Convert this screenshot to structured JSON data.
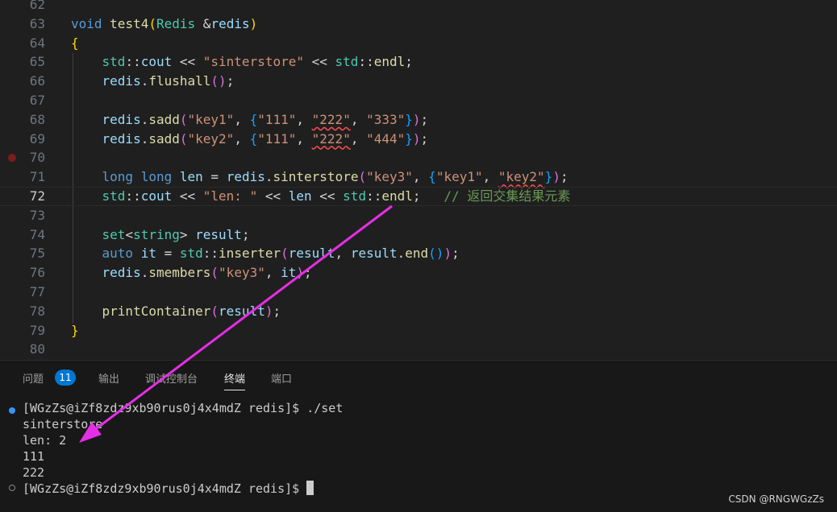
{
  "editor": {
    "lines": [
      {
        "num": "62",
        "tokens": []
      },
      {
        "num": "63",
        "tokens": [
          [
            "void",
            "#569cd6"
          ],
          [
            " ",
            ""
          ],
          [
            "test4",
            "#dcdcaa"
          ],
          [
            "(",
            "#ffd700"
          ],
          [
            "Redis",
            "#4ec9b0"
          ],
          [
            " ",
            ""
          ],
          [
            "&",
            "#d4d4d4"
          ],
          [
            "redis",
            "#9cdcfe"
          ],
          [
            ")",
            "#ffd700"
          ]
        ]
      },
      {
        "num": "64",
        "tokens": [
          [
            "{",
            "#ffd700"
          ]
        ]
      },
      {
        "num": "65",
        "tokens": [
          [
            "    ",
            ""
          ],
          [
            "std",
            "#4ec9b0"
          ],
          [
            "::",
            "#d4d4d4"
          ],
          [
            "cout",
            "#9cdcfe"
          ],
          [
            " << ",
            "#d4d4d4"
          ],
          [
            "\"sinterstore\"",
            "#ce9178"
          ],
          [
            " << ",
            "#d4d4d4"
          ],
          [
            "std",
            "#4ec9b0"
          ],
          [
            "::",
            "#d4d4d4"
          ],
          [
            "endl",
            "#dcdcaa"
          ],
          [
            ";",
            "#d4d4d4"
          ]
        ]
      },
      {
        "num": "66",
        "tokens": [
          [
            "    ",
            ""
          ],
          [
            "redis",
            "#9cdcfe"
          ],
          [
            ".",
            "#d4d4d4"
          ],
          [
            "flushall",
            "#dcdcaa"
          ],
          [
            "(",
            "#da70d6"
          ],
          [
            ")",
            "#da70d6"
          ],
          [
            ";",
            "#d4d4d4"
          ]
        ]
      },
      {
        "num": "67",
        "tokens": []
      },
      {
        "num": "68",
        "tokens": [
          [
            "    ",
            ""
          ],
          [
            "redis",
            "#9cdcfe"
          ],
          [
            ".",
            "#d4d4d4"
          ],
          [
            "sadd",
            "#dcdcaa"
          ],
          [
            "(",
            "#da70d6"
          ],
          [
            "\"key1\"",
            "#ce9178"
          ],
          [
            ", ",
            "#d4d4d4"
          ],
          [
            "{",
            "#179fff"
          ],
          [
            "\"111\"",
            "#ce9178"
          ],
          [
            ", ",
            "#d4d4d4"
          ],
          [
            "\"222\"",
            "#ce9178",
            "sq"
          ],
          [
            ", ",
            "#d4d4d4"
          ],
          [
            "\"333\"",
            "#ce9178"
          ],
          [
            "}",
            "#179fff"
          ],
          [
            ")",
            "#da70d6"
          ],
          [
            ";",
            "#d4d4d4"
          ]
        ]
      },
      {
        "num": "69",
        "tokens": [
          [
            "    ",
            ""
          ],
          [
            "redis",
            "#9cdcfe"
          ],
          [
            ".",
            "#d4d4d4"
          ],
          [
            "sadd",
            "#dcdcaa"
          ],
          [
            "(",
            "#da70d6"
          ],
          [
            "\"key2\"",
            "#ce9178"
          ],
          [
            ", ",
            "#d4d4d4"
          ],
          [
            "{",
            "#179fff"
          ],
          [
            "\"111\"",
            "#ce9178"
          ],
          [
            ", ",
            "#d4d4d4"
          ],
          [
            "\"222\"",
            "#ce9178",
            "sq"
          ],
          [
            ", ",
            "#d4d4d4"
          ],
          [
            "\"444\"",
            "#ce9178"
          ],
          [
            "}",
            "#179fff"
          ],
          [
            ")",
            "#da70d6"
          ],
          [
            ";",
            "#d4d4d4"
          ]
        ]
      },
      {
        "num": "70",
        "tokens": [],
        "breakpoint": true
      },
      {
        "num": "71",
        "tokens": [
          [
            "    ",
            ""
          ],
          [
            "long",
            "#569cd6"
          ],
          [
            " ",
            ""
          ],
          [
            "long",
            "#569cd6"
          ],
          [
            " ",
            ""
          ],
          [
            "len",
            "#9cdcfe"
          ],
          [
            " = ",
            "#d4d4d4"
          ],
          [
            "redis",
            "#9cdcfe"
          ],
          [
            ".",
            "#d4d4d4"
          ],
          [
            "sinterstore",
            "#dcdcaa"
          ],
          [
            "(",
            "#da70d6"
          ],
          [
            "\"key3\"",
            "#ce9178"
          ],
          [
            ", ",
            "#d4d4d4"
          ],
          [
            "{",
            "#179fff"
          ],
          [
            "\"key1\"",
            "#ce9178"
          ],
          [
            ", ",
            "#d4d4d4"
          ],
          [
            "\"key2\"",
            "#ce9178",
            "sq"
          ],
          [
            "}",
            "#179fff"
          ],
          [
            ")",
            "#da70d6"
          ],
          [
            ";",
            "#d4d4d4"
          ]
        ]
      },
      {
        "num": "72",
        "active": true,
        "tokens": [
          [
            "    ",
            ""
          ],
          [
            "std",
            "#4ec9b0"
          ],
          [
            "::",
            "#d4d4d4"
          ],
          [
            "cout",
            "#9cdcfe"
          ],
          [
            " << ",
            "#d4d4d4"
          ],
          [
            "\"len: \"",
            "#ce9178"
          ],
          [
            " << ",
            "#d4d4d4"
          ],
          [
            "len",
            "#9cdcfe"
          ],
          [
            " << ",
            "#d4d4d4"
          ],
          [
            "std",
            "#4ec9b0"
          ],
          [
            "::",
            "#d4d4d4"
          ],
          [
            "endl",
            "#dcdcaa"
          ],
          [
            ";",
            "#d4d4d4"
          ],
          [
            "   ",
            ""
          ],
          [
            "// 返回交集结果元素",
            "#6a9955"
          ]
        ]
      },
      {
        "num": "73",
        "tokens": []
      },
      {
        "num": "74",
        "tokens": [
          [
            "    ",
            ""
          ],
          [
            "set",
            "#4ec9b0"
          ],
          [
            "<",
            "#d4d4d4"
          ],
          [
            "string",
            "#4ec9b0"
          ],
          [
            "> ",
            "#d4d4d4"
          ],
          [
            "result",
            "#9cdcfe"
          ],
          [
            ";",
            "#d4d4d4"
          ]
        ]
      },
      {
        "num": "75",
        "tokens": [
          [
            "    ",
            ""
          ],
          [
            "auto",
            "#569cd6"
          ],
          [
            " ",
            ""
          ],
          [
            "it",
            "#9cdcfe"
          ],
          [
            " = ",
            "#d4d4d4"
          ],
          [
            "std",
            "#4ec9b0"
          ],
          [
            "::",
            "#d4d4d4"
          ],
          [
            "inserter",
            "#dcdcaa"
          ],
          [
            "(",
            "#da70d6"
          ],
          [
            "result",
            "#9cdcfe"
          ],
          [
            ", ",
            "#d4d4d4"
          ],
          [
            "result",
            "#9cdcfe"
          ],
          [
            ".",
            "#d4d4d4"
          ],
          [
            "end",
            "#dcdcaa"
          ],
          [
            "(",
            "#179fff"
          ],
          [
            ")",
            "#179fff"
          ],
          [
            ")",
            "#da70d6"
          ],
          [
            ";",
            "#d4d4d4"
          ]
        ]
      },
      {
        "num": "76",
        "tokens": [
          [
            "    ",
            ""
          ],
          [
            "redis",
            "#9cdcfe"
          ],
          [
            ".",
            "#d4d4d4"
          ],
          [
            "smembers",
            "#dcdcaa"
          ],
          [
            "(",
            "#da70d6"
          ],
          [
            "\"key3\"",
            "#ce9178"
          ],
          [
            ", ",
            "#d4d4d4"
          ],
          [
            "it",
            "#9cdcfe"
          ],
          [
            ")",
            "#da70d6"
          ],
          [
            ";",
            "#d4d4d4"
          ]
        ]
      },
      {
        "num": "77",
        "tokens": []
      },
      {
        "num": "78",
        "tokens": [
          [
            "    ",
            ""
          ],
          [
            "printContainer",
            "#dcdcaa"
          ],
          [
            "(",
            "#da70d6"
          ],
          [
            "result",
            "#9cdcfe"
          ],
          [
            ")",
            "#da70d6"
          ],
          [
            ";",
            "#d4d4d4"
          ]
        ]
      },
      {
        "num": "79",
        "tokens": [
          [
            "}",
            "#ffd700"
          ]
        ]
      },
      {
        "num": "80",
        "tokens": []
      }
    ]
  },
  "panel": {
    "tabs": [
      {
        "label": "问题",
        "name": "tab-problems"
      },
      {
        "label": "输出",
        "name": "tab-output"
      },
      {
        "label": "调试控制台",
        "name": "tab-debug-console"
      },
      {
        "label": "终端",
        "name": "tab-terminal",
        "active": true
      },
      {
        "label": "端口",
        "name": "tab-ports"
      }
    ],
    "problems_count": "11",
    "terminal": {
      "lines": [
        "[WGzZs@iZf8zdz9xb90rus0j4x4mdZ redis]$ ./set",
        "sinterstore",
        "len: 2",
        "111",
        "222",
        "[WGzZs@iZf8zdz9xb90rus0j4x4mdZ redis]$ "
      ]
    }
  },
  "watermark": "CSDN @RNGWGzZs",
  "colors": {
    "annotation_arrow": "#e62ee6",
    "background": "#1f1f1f",
    "panel_background": "#181818",
    "badge": "#0078d4"
  }
}
